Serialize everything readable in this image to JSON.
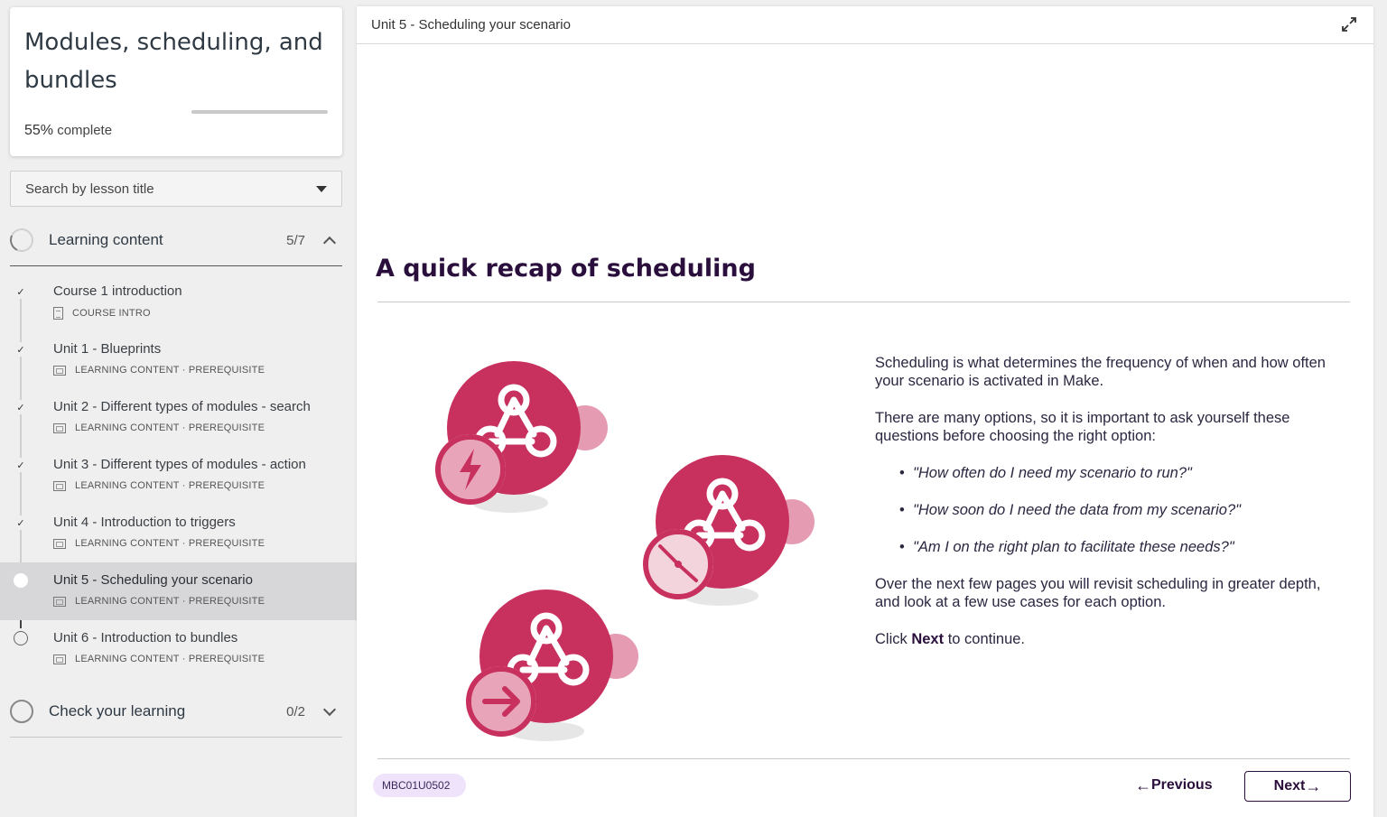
{
  "course": {
    "title": "Modules, scheduling, and bundles",
    "progress_percent": "55%",
    "progress_value": 0.55,
    "progress_suffix": " complete"
  },
  "search": {
    "placeholder": "Search by lesson title"
  },
  "sections": [
    {
      "label": "Learning content",
      "count": "5/7",
      "expanded": true
    },
    {
      "label": "Check your learning",
      "count": "0/2",
      "expanded": false
    }
  ],
  "lessons": [
    {
      "title": "Course 1 introduction",
      "meta": "COURSE INTRO",
      "status": "complete",
      "check": "✓"
    },
    {
      "title": "Unit 1 - Blueprints",
      "meta": "LEARNING CONTENT · PREREQUISITE",
      "status": "complete",
      "check": "✓"
    },
    {
      "title": "Unit 2 - Different types of modules - search",
      "meta": "LEARNING CONTENT · PREREQUISITE",
      "status": "complete",
      "check": "✓"
    },
    {
      "title": "Unit 3 - Different types of modules - action",
      "meta": "LEARNING CONTENT · PREREQUISITE",
      "status": "complete",
      "check": "✓"
    },
    {
      "title": "Unit 4 - Introduction to triggers",
      "meta": "LEARNING CONTENT · PREREQUISITE",
      "status": "complete",
      "check": "✓"
    },
    {
      "title": "Unit 5 - Scheduling your scenario",
      "meta": "LEARNING CONTENT · PREREQUISITE",
      "status": "current",
      "check": ""
    },
    {
      "title": "Unit 6 - Introduction to bundles",
      "meta": "LEARNING CONTENT · PREREQUISITE",
      "status": "todo",
      "check": ""
    }
  ],
  "main": {
    "breadcrumb": "Unit 5 - Scheduling your scenario",
    "heading": "A quick recap of scheduling",
    "para1": "Scheduling is what determines the frequency of when and how often your scenario is activated in Make.",
    "para2": "There are many options, so it is important to ask yourself these questions before choosing the right option:",
    "bullets": [
      "\"How often do I need my scenario to run?\"",
      "\"How soon do I need the data from my scenario?\"",
      "\"Am I on the right plan to facilitate these needs?\""
    ],
    "para3": "Over the next few pages you will revisit scheduling in greater depth, and look at a few use cases for each option.",
    "click_prefix": "Click ",
    "click_bold": "Next",
    "click_suffix": " to continue.",
    "code": "MBC01U0502",
    "prev_arrow": "←",
    "prev_label": " Previous",
    "next_label": "Next ",
    "next_arrow": "→"
  },
  "colors": {
    "accent": "#2a0f3c",
    "brand_pink": "#c8305e",
    "badge_bg": "#efe2fb"
  }
}
